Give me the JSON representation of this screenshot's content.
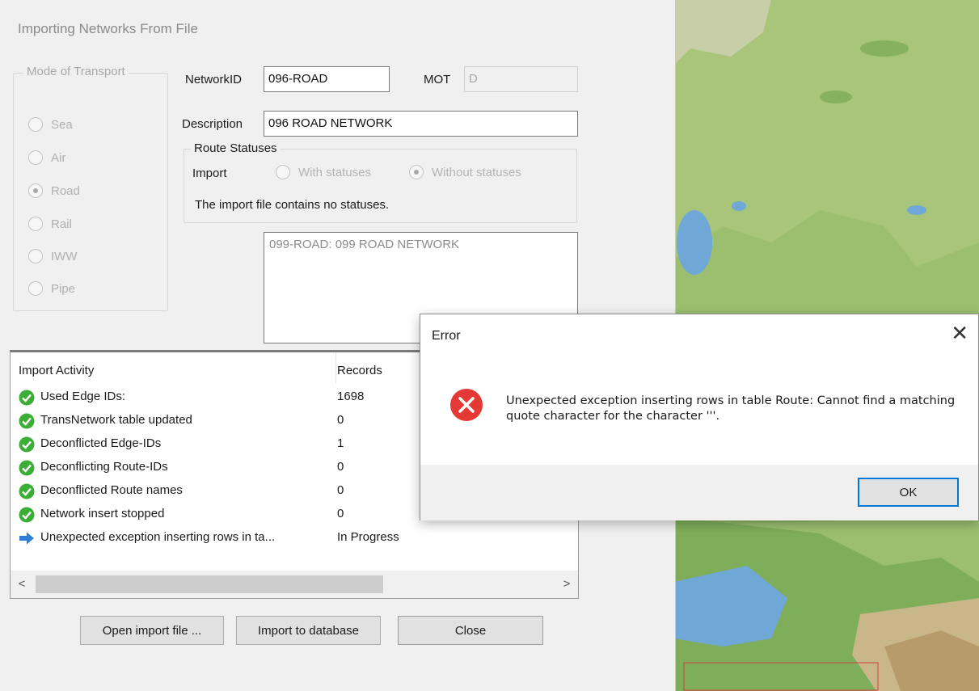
{
  "main_dialog": {
    "title": "Importing Networks From File",
    "mode_of_transport": {
      "legend": "Mode of Transport",
      "options": [
        "Sea",
        "Air",
        "Road",
        "Rail",
        "IWW",
        "Pipe"
      ],
      "selected": "Road"
    },
    "network_id": {
      "label": "NetworkID",
      "value": "096-ROAD"
    },
    "mot": {
      "label": "MOT",
      "value": "D"
    },
    "description": {
      "label": "Description",
      "value": "096 ROAD NETWORK"
    },
    "route_statuses": {
      "legend": "Route Statuses",
      "import_label": "Import",
      "options": [
        "With statuses",
        "Without statuses"
      ],
      "selected": "Without statuses",
      "info": "The import file contains no statuses."
    },
    "networks_list": [
      "099-ROAD: 099 ROAD NETWORK"
    ],
    "activity": {
      "columns": [
        "Import Activity",
        "Records"
      ],
      "rows": [
        {
          "icon": "check-icon",
          "activity": "Used Edge IDs:",
          "records": "1698"
        },
        {
          "icon": "check-icon",
          "activity": "TransNetwork table updated",
          "records": "0"
        },
        {
          "icon": "check-icon",
          "activity": "Deconflicted Edge-IDs",
          "records": "1"
        },
        {
          "icon": "check-icon",
          "activity": "Deconflicting Route-IDs",
          "records": "0"
        },
        {
          "icon": "check-icon",
          "activity": "Deconflicted Route names",
          "records": "0"
        },
        {
          "icon": "check-icon",
          "activity": "Network insert stopped",
          "records": "0"
        },
        {
          "icon": "arrow-right-icon",
          "activity": "Unexpected exception inserting rows in ta...",
          "records": "In Progress"
        }
      ]
    },
    "buttons": {
      "open_import_file": "Open import file ...",
      "import_to_database": "Import to database",
      "close": "Close"
    }
  },
  "error_dialog": {
    "title": "Error",
    "close_glyph": "✕",
    "message": "Unexpected exception inserting rows in table Route: Cannot find a matching quote character for the character '''.",
    "ok_label": "OK"
  },
  "colors": {
    "check": "#3cae37",
    "arrow": "#2f7fd8",
    "error": "#e53935",
    "ok_border": "#0078d7"
  }
}
